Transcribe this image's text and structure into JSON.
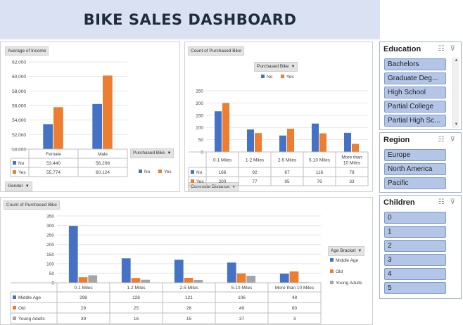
{
  "title": "BIKE SALES DASHBOARD",
  "income_chart": {
    "value_button": "Average of Income",
    "legend_button": "Purchased Bike",
    "axis_button": "Gender",
    "chart_data": {
      "type": "bar",
      "categories": [
        "Female",
        "Male"
      ],
      "series": [
        {
          "name": "No",
          "values": [
            53440,
            56208
          ]
        },
        {
          "name": "Yes",
          "values": [
            55774,
            60124
          ]
        }
      ],
      "table": [
        [
          "53,440",
          "56,208"
        ],
        [
          "55,774",
          "60,124"
        ]
      ],
      "ylim": [
        50000,
        62000
      ],
      "yticks": [
        "50,000",
        "52,000",
        "54,000",
        "56,000",
        "58,000",
        "60,000",
        "62,000"
      ],
      "colors": {
        "No": "#4472c4",
        "Yes": "#ed7d31"
      },
      "legend": "right"
    }
  },
  "commute_chart": {
    "value_button": "Count of Purchased Bike",
    "legend_button": "Purchased Bike",
    "axis_button": "Commute Distance",
    "chart_data": {
      "type": "bar",
      "categories": [
        "0-1 Miles",
        "1-2 Miles",
        "2-5 Miles",
        "5-10 Miles",
        "More than 10 Miles"
      ],
      "category_lines": [
        [
          "0-1 Miles"
        ],
        [
          "1-2 Miles"
        ],
        [
          "2-5 Miles"
        ],
        [
          "5-10 Miles"
        ],
        [
          "More than",
          "10 Miles"
        ]
      ],
      "series": [
        {
          "name": "No",
          "values": [
            166,
            92,
            67,
            116,
            78
          ]
        },
        {
          "name": "Yes",
          "values": [
            200,
            77,
            95,
            76,
            33
          ]
        }
      ],
      "table": [
        [
          "166",
          "92",
          "67",
          "116",
          "78"
        ],
        [
          "200",
          "77",
          "95",
          "76",
          "33"
        ]
      ],
      "ylim": [
        0,
        250
      ],
      "yticks": [
        "0",
        "50",
        "100",
        "150",
        "200",
        "250"
      ],
      "legend": "top"
    }
  },
  "age_chart": {
    "value_button": "Count of Purchased Bike",
    "legend_button": "Age Bracket",
    "chart_data": {
      "type": "bar",
      "categories": [
        "0-1 Miles",
        "1-2 Miles",
        "2-5 Miles",
        "5-10 Miles",
        "More than 10 Miles"
      ],
      "series": [
        {
          "name": "Middle Age",
          "values": [
            298,
            128,
            121,
            106,
            48
          ]
        },
        {
          "name": "Old",
          "values": [
            29,
            25,
            26,
            49,
            60
          ]
        },
        {
          "name": "Young Adults",
          "values": [
            39,
            16,
            15,
            37,
            3
          ]
        }
      ],
      "table": [
        [
          "298",
          "128",
          "121",
          "106",
          "48"
        ],
        [
          "29",
          "25",
          "26",
          "49",
          "60"
        ],
        [
          "39",
          "16",
          "15",
          "37",
          "3"
        ]
      ],
      "ylim": [
        0,
        350
      ],
      "yticks": [
        "0",
        "50",
        "100",
        "150",
        "200",
        "250",
        "300",
        "350"
      ],
      "colors": {
        "Middle Age": "#4472c4",
        "Old": "#ed7d31",
        "Young Adults": "#a5a5a5"
      },
      "legend": "right"
    }
  },
  "slicers": {
    "education": {
      "title": "Education",
      "items": [
        "Bachelors",
        "Graduate Deg...",
        "High School",
        "Partial College",
        "Partial High Sc..."
      ]
    },
    "region": {
      "title": "Region",
      "items": [
        "Europe",
        "North America",
        "Pacific"
      ]
    },
    "children": {
      "title": "Children",
      "items": [
        "0",
        "1",
        "2",
        "3",
        "4",
        "5"
      ]
    }
  }
}
